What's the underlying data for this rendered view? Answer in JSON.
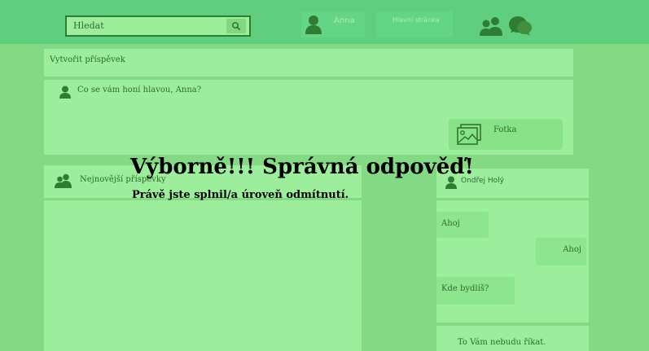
{
  "header": {
    "search_placeholder": "Hledat",
    "user_name": "Anna",
    "home_label": "Hlavní stránka",
    "icons": [
      "search-icon",
      "person-icon",
      "people-icon",
      "chat-bubbles-icon"
    ]
  },
  "create_post": {
    "title": "Vytvořit příspěvek",
    "prompt": "Co se vám honí hlavou, Anna?",
    "photo_label": "Fotka"
  },
  "news": {
    "title": "Nejnovější příspěvky"
  },
  "chat": {
    "contact": "Ondřej Holý",
    "messages": [
      {
        "text": "Ahoj",
        "side": "left"
      },
      {
        "text": "Ahoj",
        "side": "right"
      },
      {
        "text": "Kde bydlíš?",
        "side": "left"
      }
    ],
    "reply": "To Vám nebudu říkat."
  },
  "overlay": {
    "title": "Výborně!!! Správná odpověď!",
    "subtitle": "Právě jste splnil/a úroveň odmítnutí."
  },
  "colors": {
    "background": "#84d984",
    "topbar": "#5fcf7f",
    "panel": "#9cee9c",
    "accent": "#2e7d32"
  }
}
